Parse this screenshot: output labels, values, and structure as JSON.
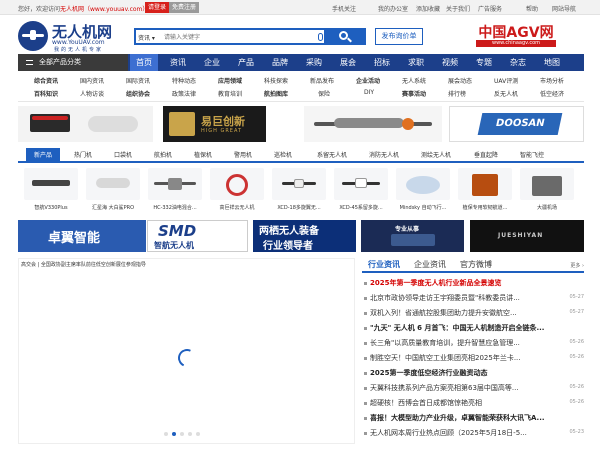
{
  "topbar": {
    "welcome_prefix": "您好，欢迎访问",
    "welcome_site": "无人机网（www.youuav.com）",
    "welcome_suffix": "!",
    "login": "请登录",
    "register": "免费注册",
    "links": [
      "手机关注",
      "我的办公室",
      "添加收藏",
      "关于我们",
      "广告服务",
      "帮助",
      "网站导航"
    ]
  },
  "header": {
    "logo_name": "无人机网",
    "logo_url": "www.YouUAV.com",
    "logo_slogan": "我的无人机专家",
    "search_category": "资讯",
    "search_placeholder": "请输入关键字",
    "post_button": "发布询价单",
    "agv_title": "中国AGV网",
    "agv_url": "www.chinaagv.com"
  },
  "nav": {
    "all_products": "全部产品分类",
    "items": [
      "首页",
      "资讯",
      "企业",
      "产品",
      "品牌",
      "采购",
      "展会",
      "招标",
      "求职",
      "视频",
      "专题",
      "杂志",
      "地图"
    ]
  },
  "subcats": {
    "row1": [
      "综合资讯",
      "国内资讯",
      "国际资讯",
      "特种动态",
      "应用领域",
      "科技探索",
      "新品发布",
      "企业活动",
      "无人系统",
      "展会动态",
      "UAV评测",
      "市场分析"
    ],
    "row2": [
      "百科知识",
      "人物访谈",
      "组织协会",
      "政策法律",
      "教育培训",
      "航拍图库",
      "保险",
      "DIY",
      "赛事活动",
      "排行榜",
      "反无人机",
      "低空经济"
    ]
  },
  "banners": {
    "ad2_text": "易巨创新",
    "ad2_sub": "HIGH GREAT",
    "ad4_text": "DOOSAN"
  },
  "product_tabs": [
    "新产品",
    "热门机",
    "口袋机",
    "航拍机",
    "植保机",
    "警用机",
    "巡检机",
    "系留无人机",
    "消防无人机",
    "测绘无人机",
    "垂直起降",
    "智能飞控"
  ],
  "products": [
    {
      "name": "智航V330Plus"
    },
    {
      "name": "汇星海 大白鲨PRO"
    },
    {
      "name": "HC-332油电混合..."
    },
    {
      "name": "高巨祥云无人机"
    },
    {
      "name": "XCD-18多旋翼无..."
    },
    {
      "name": "XCD-45系留多旋..."
    },
    {
      "name": "Mindsky 自动飞行..."
    },
    {
      "name": "植保专用软韧航道..."
    },
    {
      "name": "大疆机场"
    }
  ],
  "banners2": {
    "b1": "卓翼智能",
    "b2": "SMD",
    "b2_sub": "智航无人机",
    "b3": "两栖无人装备",
    "b3_sub": "行业领导者",
    "b4": "专业从事",
    "b5": "JUESHIYAN"
  },
  "slider": {
    "caption": "高交会 | 全国政协副主席率队前往低空创新展位参观指导",
    "dots": 5,
    "active_dot": 2
  },
  "news": {
    "tabs": [
      "行业资讯",
      "企业资讯",
      "官方微博"
    ],
    "more": "更多",
    "items": [
      {
        "text": "2025年第一季度无人机行业新品全景速览",
        "date": "",
        "style": "hl"
      },
      {
        "text": "北京市政协领导走访王宇翔委员暨\"科教委员讲...",
        "date": "05-27",
        "style": ""
      },
      {
        "text": "双机入列！省通航控股集团助力提升安徽航空...",
        "date": "05-27",
        "style": ""
      },
      {
        "text": "\"九天\" 无人机 6 月首飞：中国无人机制造开启全链条...",
        "date": "",
        "style": "bold"
      },
      {
        "text": "长三角\"以高质量教育培训，提升智慧应急管理...",
        "date": "05-26",
        "style": ""
      },
      {
        "text": "制胜空天！中国航空工业集团亮相2025年兰卡...",
        "date": "05-26",
        "style": ""
      },
      {
        "text": "2025第一季度低空经济行业融资动态",
        "date": "",
        "style": "bold"
      },
      {
        "text": "天翼科技携系列产品方案亮相第63届中国高等...",
        "date": "05-26",
        "style": ""
      },
      {
        "text": "超硬核！西博会首日成都馆惊艳亮相",
        "date": "05-26",
        "style": ""
      },
      {
        "text": "喜报！大模型助力产业升级，卓翼智能荣获科大讯飞A...",
        "date": "",
        "style": "bold"
      },
      {
        "text": "无人机网本周行业热点回顾（2025年5月18日-5...",
        "date": "05-23",
        "style": ""
      }
    ]
  },
  "colors": {
    "brand": "#1c3f8a",
    "accent": "#1e5fbf",
    "highlight": "#d40000"
  }
}
